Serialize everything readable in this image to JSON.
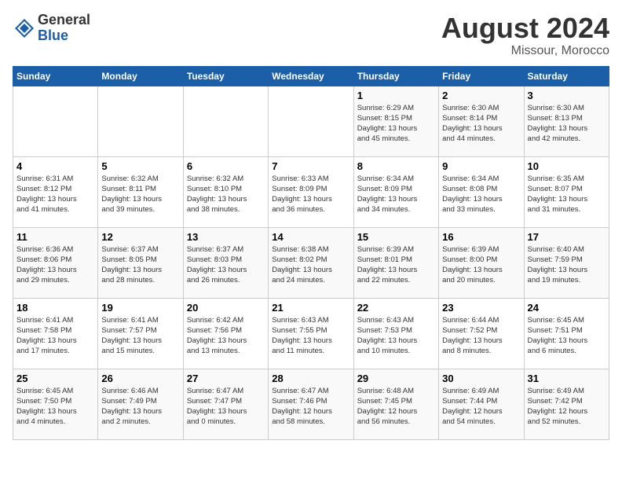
{
  "logo": {
    "general": "General",
    "blue": "Blue"
  },
  "title": "August 2024",
  "location": "Missour, Morocco",
  "days_of_week": [
    "Sunday",
    "Monday",
    "Tuesday",
    "Wednesday",
    "Thursday",
    "Friday",
    "Saturday"
  ],
  "weeks": [
    [
      {
        "day": "",
        "info": ""
      },
      {
        "day": "",
        "info": ""
      },
      {
        "day": "",
        "info": ""
      },
      {
        "day": "",
        "info": ""
      },
      {
        "day": "1",
        "info": "Sunrise: 6:29 AM\nSunset: 8:15 PM\nDaylight: 13 hours\nand 45 minutes."
      },
      {
        "day": "2",
        "info": "Sunrise: 6:30 AM\nSunset: 8:14 PM\nDaylight: 13 hours\nand 44 minutes."
      },
      {
        "day": "3",
        "info": "Sunrise: 6:30 AM\nSunset: 8:13 PM\nDaylight: 13 hours\nand 42 minutes."
      }
    ],
    [
      {
        "day": "4",
        "info": "Sunrise: 6:31 AM\nSunset: 8:12 PM\nDaylight: 13 hours\nand 41 minutes."
      },
      {
        "day": "5",
        "info": "Sunrise: 6:32 AM\nSunset: 8:11 PM\nDaylight: 13 hours\nand 39 minutes."
      },
      {
        "day": "6",
        "info": "Sunrise: 6:32 AM\nSunset: 8:10 PM\nDaylight: 13 hours\nand 38 minutes."
      },
      {
        "day": "7",
        "info": "Sunrise: 6:33 AM\nSunset: 8:09 PM\nDaylight: 13 hours\nand 36 minutes."
      },
      {
        "day": "8",
        "info": "Sunrise: 6:34 AM\nSunset: 8:09 PM\nDaylight: 13 hours\nand 34 minutes."
      },
      {
        "day": "9",
        "info": "Sunrise: 6:34 AM\nSunset: 8:08 PM\nDaylight: 13 hours\nand 33 minutes."
      },
      {
        "day": "10",
        "info": "Sunrise: 6:35 AM\nSunset: 8:07 PM\nDaylight: 13 hours\nand 31 minutes."
      }
    ],
    [
      {
        "day": "11",
        "info": "Sunrise: 6:36 AM\nSunset: 8:06 PM\nDaylight: 13 hours\nand 29 minutes."
      },
      {
        "day": "12",
        "info": "Sunrise: 6:37 AM\nSunset: 8:05 PM\nDaylight: 13 hours\nand 28 minutes."
      },
      {
        "day": "13",
        "info": "Sunrise: 6:37 AM\nSunset: 8:03 PM\nDaylight: 13 hours\nand 26 minutes."
      },
      {
        "day": "14",
        "info": "Sunrise: 6:38 AM\nSunset: 8:02 PM\nDaylight: 13 hours\nand 24 minutes."
      },
      {
        "day": "15",
        "info": "Sunrise: 6:39 AM\nSunset: 8:01 PM\nDaylight: 13 hours\nand 22 minutes."
      },
      {
        "day": "16",
        "info": "Sunrise: 6:39 AM\nSunset: 8:00 PM\nDaylight: 13 hours\nand 20 minutes."
      },
      {
        "day": "17",
        "info": "Sunrise: 6:40 AM\nSunset: 7:59 PM\nDaylight: 13 hours\nand 19 minutes."
      }
    ],
    [
      {
        "day": "18",
        "info": "Sunrise: 6:41 AM\nSunset: 7:58 PM\nDaylight: 13 hours\nand 17 minutes."
      },
      {
        "day": "19",
        "info": "Sunrise: 6:41 AM\nSunset: 7:57 PM\nDaylight: 13 hours\nand 15 minutes."
      },
      {
        "day": "20",
        "info": "Sunrise: 6:42 AM\nSunset: 7:56 PM\nDaylight: 13 hours\nand 13 minutes."
      },
      {
        "day": "21",
        "info": "Sunrise: 6:43 AM\nSunset: 7:55 PM\nDaylight: 13 hours\nand 11 minutes."
      },
      {
        "day": "22",
        "info": "Sunrise: 6:43 AM\nSunset: 7:53 PM\nDaylight: 13 hours\nand 10 minutes."
      },
      {
        "day": "23",
        "info": "Sunrise: 6:44 AM\nSunset: 7:52 PM\nDaylight: 13 hours\nand 8 minutes."
      },
      {
        "day": "24",
        "info": "Sunrise: 6:45 AM\nSunset: 7:51 PM\nDaylight: 13 hours\nand 6 minutes."
      }
    ],
    [
      {
        "day": "25",
        "info": "Sunrise: 6:45 AM\nSunset: 7:50 PM\nDaylight: 13 hours\nand 4 minutes."
      },
      {
        "day": "26",
        "info": "Sunrise: 6:46 AM\nSunset: 7:49 PM\nDaylight: 13 hours\nand 2 minutes."
      },
      {
        "day": "27",
        "info": "Sunrise: 6:47 AM\nSunset: 7:47 PM\nDaylight: 13 hours\nand 0 minutes."
      },
      {
        "day": "28",
        "info": "Sunrise: 6:47 AM\nSunset: 7:46 PM\nDaylight: 12 hours\nand 58 minutes."
      },
      {
        "day": "29",
        "info": "Sunrise: 6:48 AM\nSunset: 7:45 PM\nDaylight: 12 hours\nand 56 minutes."
      },
      {
        "day": "30",
        "info": "Sunrise: 6:49 AM\nSunset: 7:44 PM\nDaylight: 12 hours\nand 54 minutes."
      },
      {
        "day": "31",
        "info": "Sunrise: 6:49 AM\nSunset: 7:42 PM\nDaylight: 12 hours\nand 52 minutes."
      }
    ]
  ]
}
